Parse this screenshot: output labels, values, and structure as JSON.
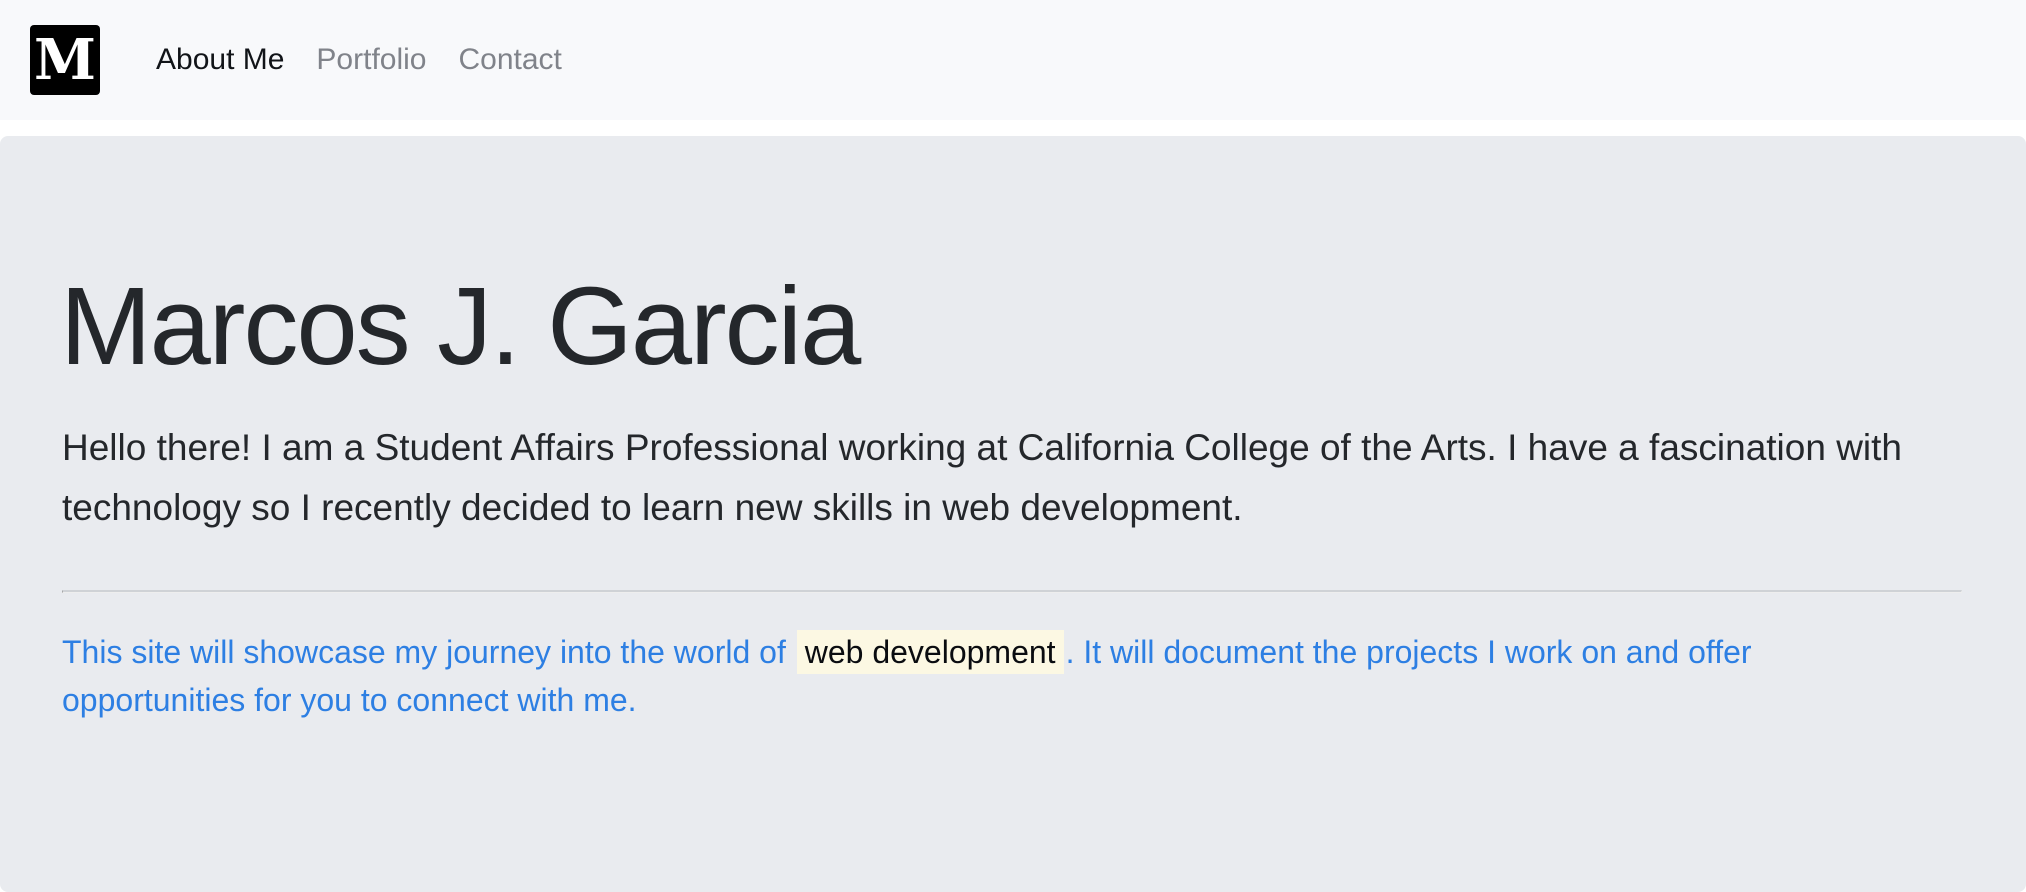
{
  "navbar": {
    "brand_letter": "M",
    "links": [
      {
        "label": "About Me",
        "active": true
      },
      {
        "label": "Portfolio",
        "active": false
      },
      {
        "label": "Contact",
        "active": false
      }
    ]
  },
  "jumbotron": {
    "title": "Marcos J. Garcia",
    "lead": "Hello there! I am a Student Affairs Professional working at California College of the Arts. I have a fascination with technology so I recently decided to learn new skills in web development.",
    "info_before": "This site will showcase my journey into the world of ",
    "info_highlight": "web development",
    "info_after": ". It will document the projects I work on and offer opportunities for you to connect with me."
  },
  "colors": {
    "navbar_bg": "#f8f9fb",
    "jumbotron_bg": "#e9ebef",
    "link_active": "#111418",
    "link_inactive": "#80838a",
    "info_text": "#2d7fe3",
    "highlight_bg": "#fcf8e3"
  }
}
